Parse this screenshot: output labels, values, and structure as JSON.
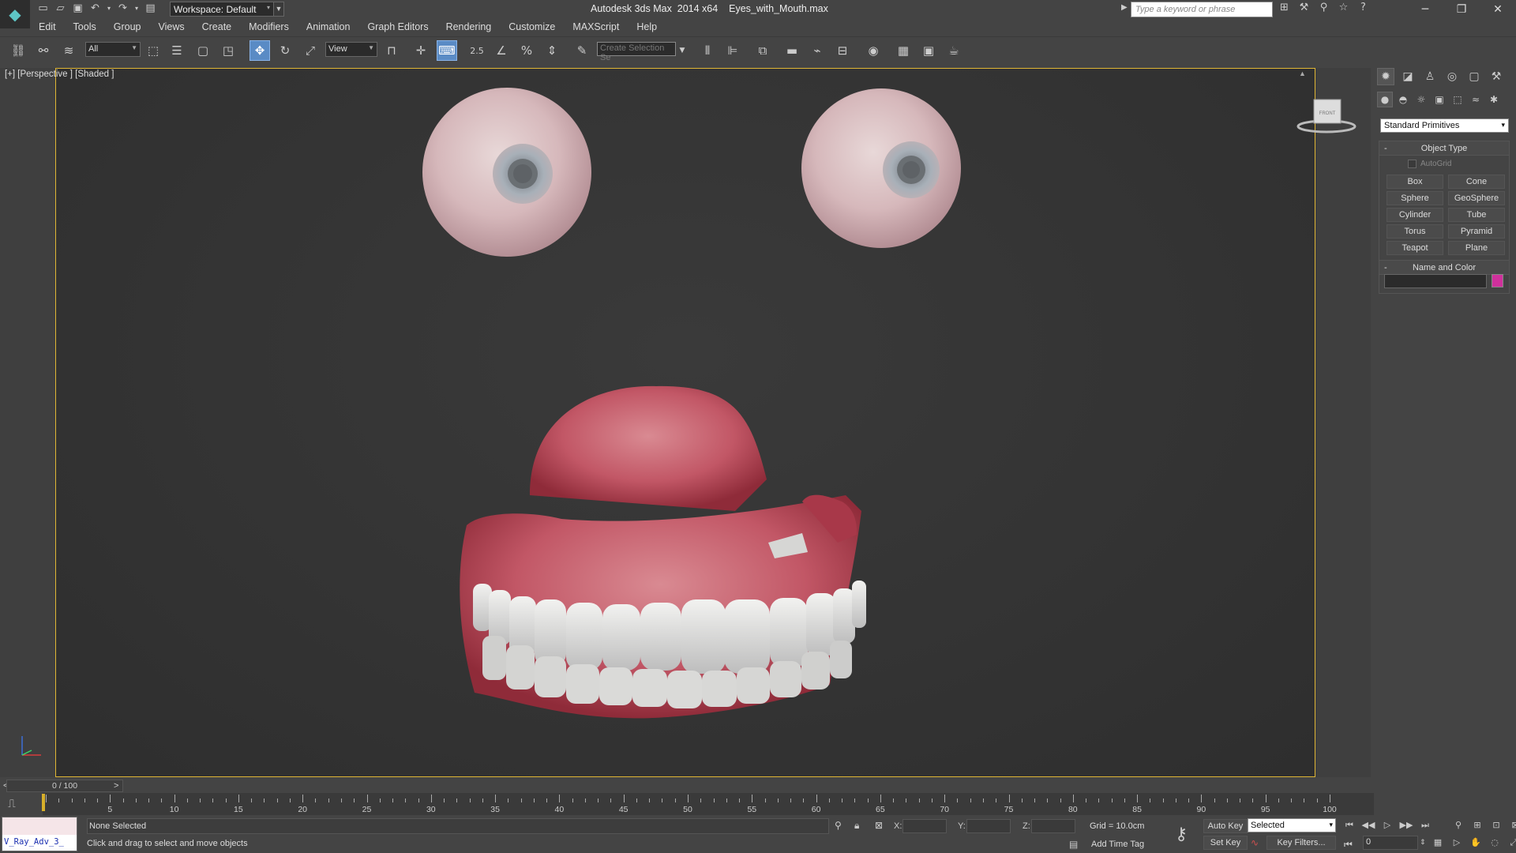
{
  "window": {
    "app_title": "Autodesk 3ds Max  2014 x64",
    "file_name": "Eyes_with_Mouth.max",
    "workspace": "Workspace: Default",
    "search_placeholder": "Type a keyword or phrase"
  },
  "menu": [
    "Edit",
    "Tools",
    "Group",
    "Views",
    "Create",
    "Modifiers",
    "Animation",
    "Graph Editors",
    "Rendering",
    "Customize",
    "MAXScript",
    "Help"
  ],
  "toolbar": {
    "selection_filter": "All",
    "ref_coord": "View",
    "snap_label": "2.5",
    "named_selection_placeholder": "Create Selection Se"
  },
  "viewport": {
    "label": "[+] [Perspective ] [Shaded ]",
    "viewcube_face": "FRONT"
  },
  "command_panel": {
    "category": "Standard Primitives",
    "object_type_title": "Object Type",
    "autogrid": "AutoGrid",
    "buttons": [
      "Box",
      "Cone",
      "Sphere",
      "GeoSphere",
      "Cylinder",
      "Tube",
      "Torus",
      "Pyramid",
      "Teapot",
      "Plane"
    ],
    "name_color_title": "Name and Color",
    "object_color": "#d0309c"
  },
  "timeline": {
    "slider_label": "0 / 100",
    "ticks": [
      5,
      10,
      15,
      20,
      25,
      30,
      35,
      40,
      45,
      50,
      55,
      60,
      65,
      70,
      75,
      80,
      85,
      90,
      95,
      100
    ]
  },
  "status": {
    "maxscript_text": "V_Ray_Adv_3_",
    "selection": "None Selected",
    "prompt": "Click and drag to select and move objects",
    "x_label": "X:",
    "y_label": "Y:",
    "z_label": "Z:",
    "grid": "Grid = 10.0cm",
    "add_time_tag": "Add Time Tag",
    "auto_key": "Auto Key",
    "set_key": "Set Key",
    "key_mode": "Selected",
    "key_filters": "Key Filters...",
    "current_frame": "0"
  },
  "colors": {
    "viewport_border": "#e0b634",
    "accent_selected": "#5a8bc5"
  }
}
